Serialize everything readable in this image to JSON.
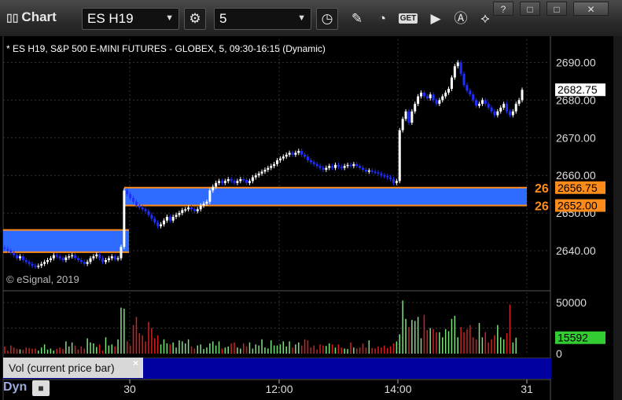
{
  "window": {
    "title": "Chart",
    "help_btn": "?",
    "restore_btn": "□",
    "max_btn": "□",
    "close_btn": "✕"
  },
  "toolbar": {
    "symbol": "ES H19",
    "interval": "5",
    "get_label": "GET",
    "icons": [
      "gear-icon",
      "clock-icon",
      "pencil-icon",
      "study-icon",
      "get-icon",
      "play-icon",
      "alert-icon",
      "trade-icon"
    ]
  },
  "header_text": "* ES H19, S&P 500 E-MINI FUTURES - GLOBEX, 5, 09:30-16:15 (Dynamic)",
  "watermark": "© eSignal, 2019",
  "colors": {
    "up": "#ffffff",
    "down": "#1f2fff",
    "band": "#2f6bff",
    "band_line": "#ff8c1a",
    "price_tag": "#ffffff",
    "vol_up": "#7fe07f",
    "vol_down": "#d52020",
    "vol_tag": "#33cc33"
  },
  "chart_data": {
    "type": "candlestick",
    "title": "* ES H19, S&P 500 E-MINI FUTURES - GLOBEX, 5, 09:30-16:15 (Dynamic)",
    "price_axis": {
      "ticks": [
        2640,
        2650,
        2660,
        2670,
        2680,
        2690
      ],
      "ylim": [
        2632,
        2694
      ]
    },
    "time_axis": {
      "labels": [
        "30",
        "12:00",
        "14:00",
        "31"
      ]
    },
    "price_tags": [
      {
        "label": "2682.75",
        "value": 2682.75,
        "style": "last"
      },
      {
        "label": "2656.75",
        "value": 2656.75,
        "style": "level"
      },
      {
        "label": "2652.00",
        "value": 2652.0,
        "style": "level"
      }
    ],
    "level_prefix": "26",
    "zones": [
      {
        "top": 2645.5,
        "bottom": 2639.6,
        "t_start": 0,
        "t_end": 38
      },
      {
        "top": 2656.75,
        "bottom": 2652.0,
        "t_start": 38,
        "t_end": 160
      }
    ],
    "close": [
      2640.5,
      2640,
      2639.5,
      2638.8,
      2638,
      2638.5,
      2637.5,
      2637,
      2636.5,
      2636,
      2635.8,
      2636,
      2636.5,
      2637,
      2637.5,
      2638,
      2638.8,
      2638.5,
      2638,
      2637.5,
      2638.2,
      2638.5,
      2638.8,
      2638,
      2637.5,
      2637,
      2636.5,
      2637,
      2638,
      2638.5,
      2639,
      2638,
      2637,
      2637.5,
      2638,
      2638.5,
      2637.8,
      2638,
      2641,
      2656,
      2655,
      2654,
      2653,
      2652,
      2651.5,
      2651,
      2650.5,
      2649.5,
      2648.5,
      2647.5,
      2646.5,
      2647,
      2648,
      2649,
      2648,
      2649,
      2649.5,
      2650,
      2650.8,
      2651,
      2651.5,
      2651,
      2650.5,
      2651,
      2652,
      2652.5,
      2653,
      2656,
      2657,
      2658,
      2658.5,
      2658,
      2658.5,
      2659,
      2658.5,
      2658,
      2658.5,
      2659,
      2658.8,
      2658,
      2658.5,
      2659.5,
      2660,
      2660.5,
      2661,
      2661.5,
      2662,
      2662.5,
      2663,
      2664,
      2664.5,
      2665,
      2665.5,
      2666,
      2665.5,
      2666,
      2666.5,
      2665.5,
      2665,
      2664,
      2663.5,
      2663,
      2662.5,
      2662,
      2661.5,
      2662,
      2662.5,
      2662,
      2662.8,
      2662.3,
      2662,
      2662.5,
      2662.8,
      2662.5,
      2663,
      2662.5,
      2662,
      2661.5,
      2661,
      2661.3,
      2661,
      2660.8,
      2660.5,
      2660,
      2659.8,
      2659.5,
      2659,
      2658,
      2658.5,
      2672,
      2675,
      2677,
      2674,
      2677,
      2679,
      2681,
      2682,
      2681,
      2680.5,
      2681.5,
      2680,
      2679,
      2680,
      2681,
      2682,
      2683,
      2686,
      2689,
      2690,
      2687,
      2684,
      2682.5,
      2681.5,
      2680,
      2678.5,
      2679,
      2680,
      2679,
      2678,
      2677,
      2676,
      2677,
      2678,
      2679,
      2677,
      2676,
      2677,
      2679,
      2680,
      2682.75
    ],
    "volume_axis": {
      "ticks": [
        0,
        50000
      ],
      "last": 15592
    },
    "volume": [
      7000,
      3000,
      8000,
      6000,
      4500,
      4200,
      3800,
      6000,
      5500,
      4800,
      5000,
      3000,
      6000,
      9000,
      4000,
      5000,
      3000,
      4500,
      6000,
      4500,
      12000,
      7000,
      11000,
      8000,
      4000,
      7000,
      5000,
      15000,
      11000,
      10000,
      6500,
      9000,
      3000,
      16000,
      8000,
      9000,
      7000,
      14000,
      45000,
      44000,
      12000,
      8000,
      28000,
      36000,
      20000,
      18000,
      12000,
      31000,
      25000,
      15000,
      18000,
      9000,
      14000,
      10000,
      9000,
      11000,
      6000,
      13000,
      12000,
      10000,
      14000,
      7000,
      5000,
      8000,
      9000,
      4500,
      6000,
      10000,
      12000,
      8000,
      12000,
      5000,
      6000,
      7000,
      10000,
      11000,
      6000,
      5000,
      10000,
      7000,
      11000,
      5000,
      9000,
      8000,
      14000,
      6000,
      5000,
      13000,
      8000,
      8000,
      9000,
      12000,
      7000,
      12000,
      6000,
      9000,
      11000,
      8000,
      14000,
      13000,
      6000,
      8000,
      4000,
      9000,
      8000,
      7500,
      10000,
      9000,
      6000,
      9000,
      6000,
      5000,
      4500,
      11000,
      6000,
      5000,
      6000,
      10000,
      6000,
      13000,
      5500,
      5000,
      7000,
      6000,
      8000,
      5500,
      7000,
      10000,
      12000,
      19000,
      52000,
      34000,
      26000,
      33000,
      32000,
      36000,
      15000,
      38000,
      23000,
      25000,
      24000,
      21000,
      21000,
      16000,
      24000,
      22000,
      34000,
      37000,
      16000,
      26000,
      21000,
      24000,
      28000,
      16000,
      14000,
      30000,
      16000,
      21000,
      11000,
      14000,
      18000,
      28000,
      16000,
      14000,
      20000,
      48000,
      11000,
      15592
    ]
  },
  "legend": {
    "label": "Vol (current price bar)",
    "close": "×"
  },
  "bottom": {
    "dyn": "Dyn",
    "lock": "🔒"
  }
}
